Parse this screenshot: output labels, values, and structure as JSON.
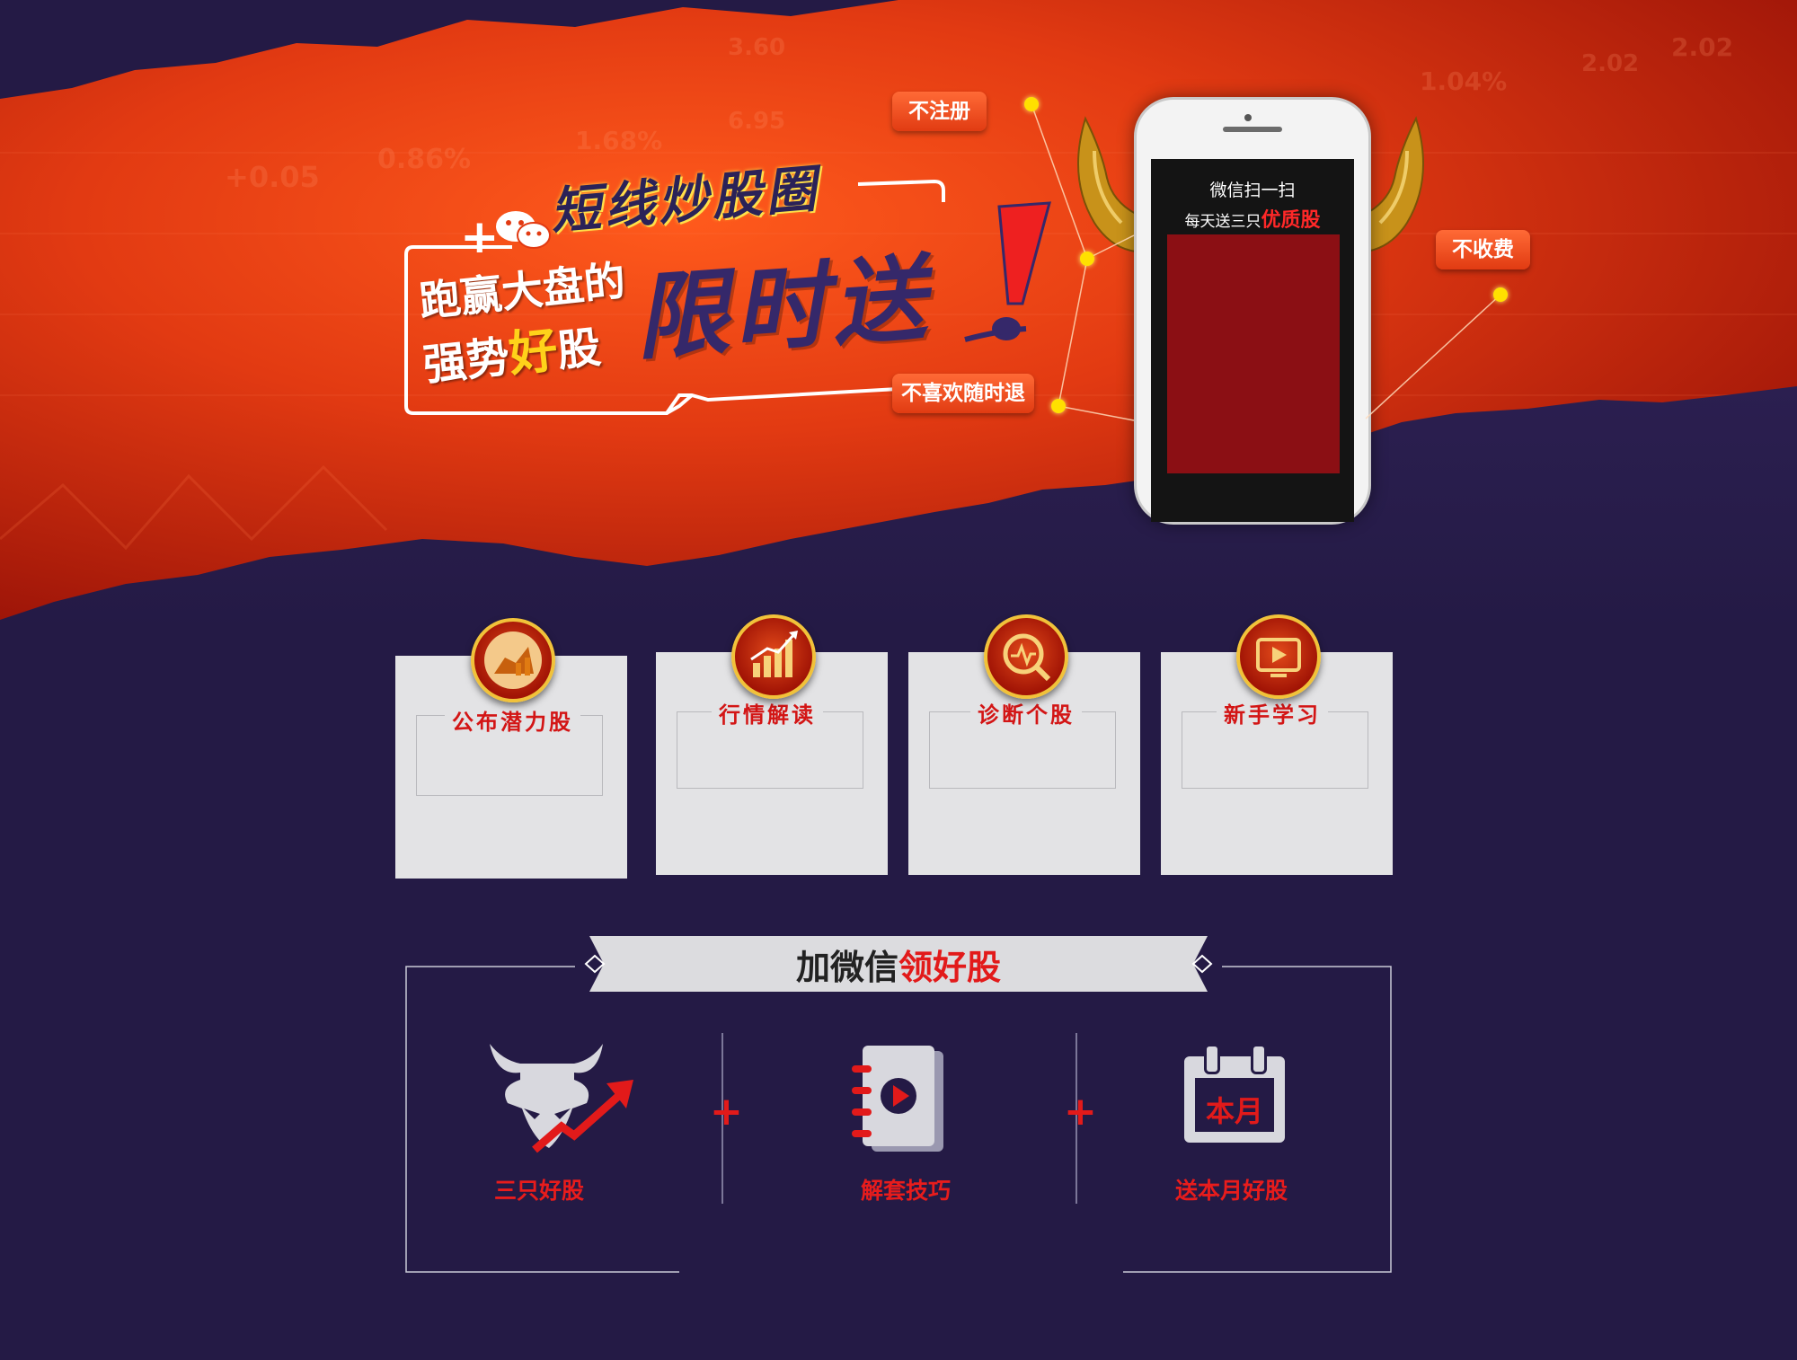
{
  "hero": {
    "brand_text": "短线炒股圈",
    "headline_line1": "跑赢大盘的",
    "headline_line2_a": "强势",
    "headline_line2_b": "好",
    "headline_line2_c": "股",
    "promo": "限时送",
    "faint_numbers": [
      "0.86%",
      "+0.05",
      "1.68%",
      "6.95",
      "3.60",
      "2.02",
      "1.04%",
      "2.02"
    ]
  },
  "phone": {
    "line1": "微信扫一扫",
    "line2_a": "每天送三只",
    "line2_b": "优质股"
  },
  "callouts": {
    "no_register": "不注册",
    "no_fee": "不收费",
    "quit_anytime": "不喜欢随时退"
  },
  "features": [
    {
      "label": "公布潜力股",
      "icon": "bull-chart-icon"
    },
    {
      "label": "行情解读",
      "icon": "rising-bars-icon"
    },
    {
      "label": "诊断个股",
      "icon": "magnify-pulse-icon"
    },
    {
      "label": "新手学习",
      "icon": "video-play-icon"
    }
  ],
  "banner": {
    "title_a": "加微信",
    "title_b": "领好股"
  },
  "benefits": [
    {
      "label": "三只好股",
      "icon": "bull-arrow-icon"
    },
    {
      "label": "解套技巧",
      "icon": "video-notebook-icon"
    },
    {
      "label": "送本月好股",
      "icon": "calendar-icon",
      "icon_text": "本月"
    }
  ],
  "plus_sign": "+",
  "colors": {
    "background": "#241a45",
    "hero_red": "#e8421a",
    "accent_red": "#e21a1a",
    "callout_orange": "#f25522",
    "gold": "#f1c23a"
  }
}
